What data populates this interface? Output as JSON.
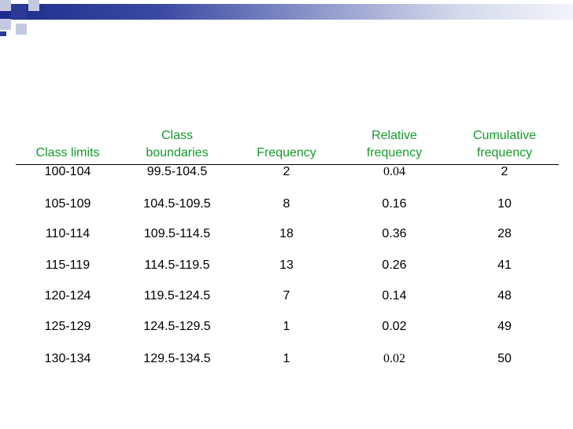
{
  "colors": {
    "header_text": "#149a2a",
    "banner_navy": "#1c2c8c",
    "banner_light": "#c4c9e2",
    "rule": "#000000"
  },
  "table": {
    "headers": [
      [
        "",
        "Class limits"
      ],
      [
        "Class",
        "boundaries"
      ],
      [
        "",
        "Frequency"
      ],
      [
        "Relative",
        "frequency"
      ],
      [
        "Cumulative",
        "frequency"
      ]
    ],
    "rows": [
      [
        "100-104",
        "99.5-104.5",
        "2",
        "0.04",
        "2"
      ],
      [
        "105-109",
        "104.5-109.5",
        "8",
        "0.16",
        "10"
      ],
      [
        "110-114",
        "109.5-114.5",
        "18",
        "0.36",
        "28"
      ],
      [
        "115-119",
        "114.5-119.5",
        "13",
        "0.26",
        "41"
      ],
      [
        "120-124",
        "119.5-124.5",
        "7",
        "0.14",
        "48"
      ],
      [
        "125-129",
        "124.5-129.5",
        "1",
        "0.02",
        "49"
      ],
      [
        "130-134",
        "129.5-134.5",
        "1",
        "0.02",
        "50"
      ]
    ]
  }
}
